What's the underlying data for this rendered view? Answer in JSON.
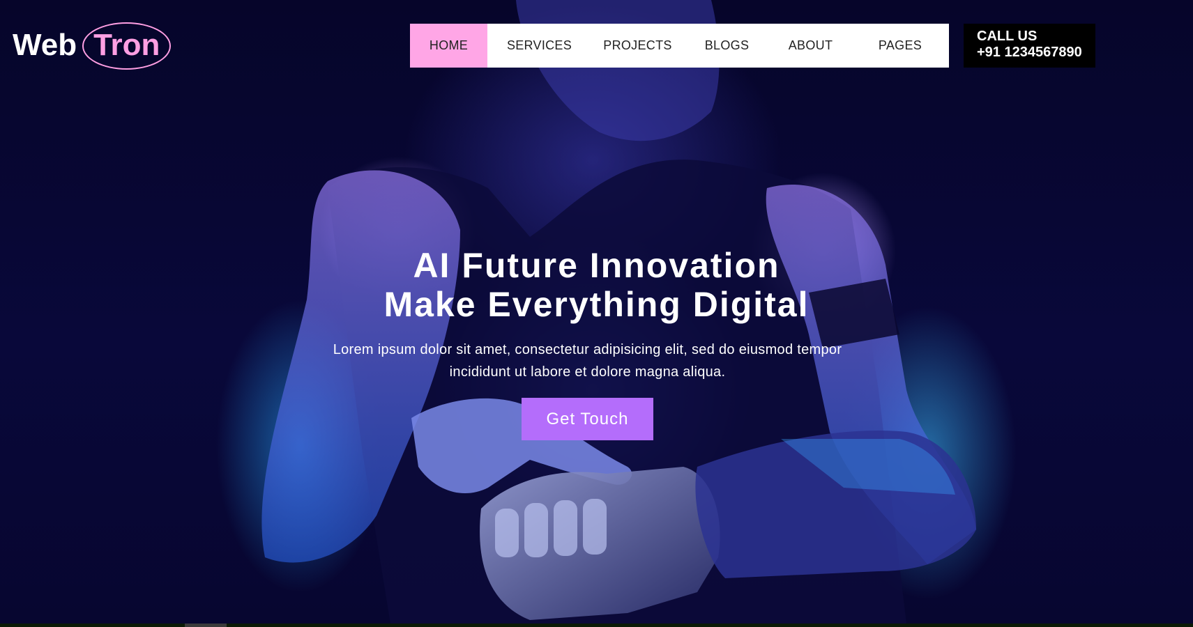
{
  "brand": {
    "name_part1": "Web",
    "name_part2": "Tron",
    "accent_color": "#ff9fe3"
  },
  "nav": {
    "items": [
      {
        "label": "HOME",
        "active": true
      },
      {
        "label": "SERVICES"
      },
      {
        "label": "PROJECTS"
      },
      {
        "label": "BLOGS"
      },
      {
        "label": "ABOUT"
      },
      {
        "label": "PAGES"
      }
    ],
    "active_color": "#ffa6e6"
  },
  "contact": {
    "label": "CALL US",
    "phone": "+91 1234567890"
  },
  "hero": {
    "title_line1": "AI Future Innovation",
    "title_line2": "Make Everything Digital",
    "subtitle": "Lorem ipsum dolor sit amet, consectetur adipisicing elit, sed do eiusmod tempor incididunt ut labore et dolore magna aliqua.",
    "cta_label": "Get Touch",
    "cta_color": "#b46dfb"
  }
}
